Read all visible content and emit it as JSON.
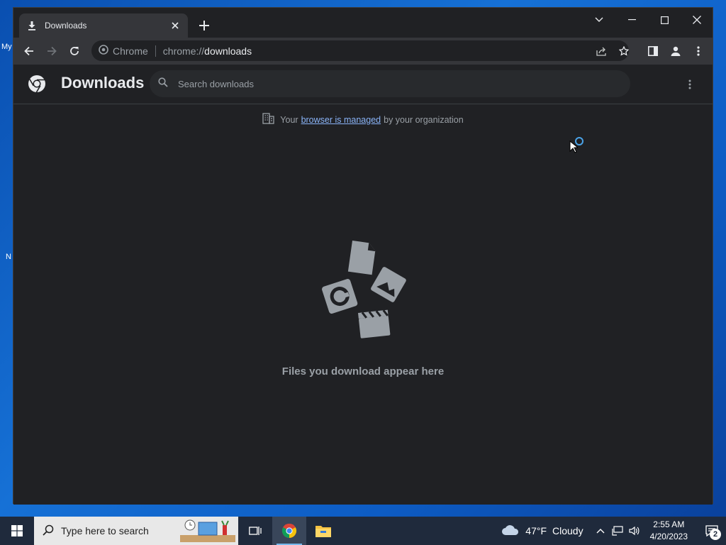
{
  "desktop": {
    "fragments": [
      "My",
      "N"
    ]
  },
  "tab": {
    "title": "Downloads"
  },
  "omnibox": {
    "site_label": "Chrome",
    "url_scheme": "chrome://",
    "url_host": "downloads"
  },
  "downloads": {
    "title": "Downloads",
    "search_placeholder": "Search downloads",
    "managed_prefix": "Your",
    "managed_link": "browser is managed",
    "managed_suffix": "by your organization",
    "empty_text": "Files you download appear here"
  },
  "taskbar": {
    "search_placeholder": "Type here to search",
    "weather_temp": "47°F",
    "weather_cond": "Cloudy",
    "time": "2:55 AM",
    "date": "4/20/2023",
    "notification_count": "2"
  }
}
